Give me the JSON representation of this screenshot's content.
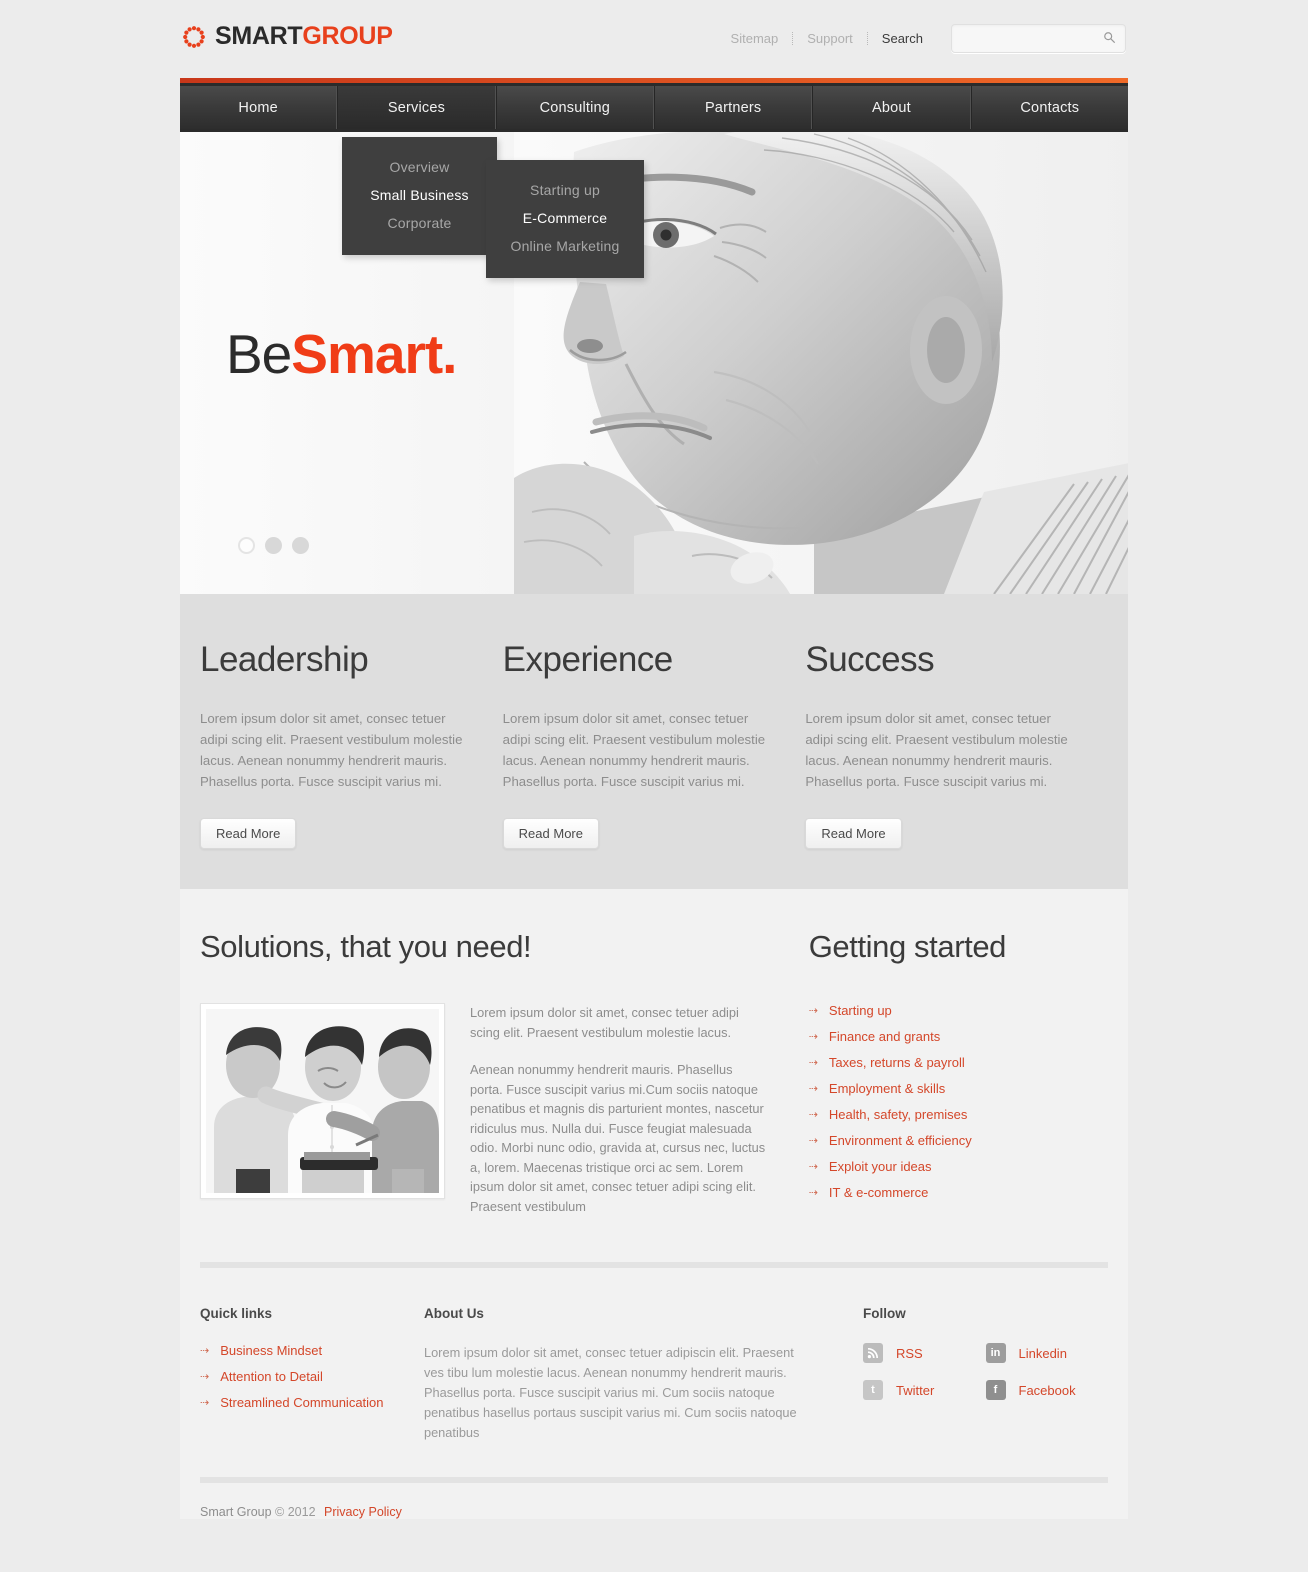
{
  "header": {
    "logo": {
      "part1": "SMART",
      "part2": "GROUP",
      "icon": "gear-ring-icon"
    },
    "toplinks": [
      {
        "label": "Sitemap",
        "style": "muted"
      },
      {
        "label": "Support",
        "style": "muted"
      },
      {
        "label": "Search",
        "style": "dark"
      }
    ],
    "search": {
      "value": "",
      "placeholder": "",
      "icon": "search-icon"
    }
  },
  "nav": {
    "items": [
      {
        "label": "Home",
        "active": false
      },
      {
        "label": "Services",
        "active": true
      },
      {
        "label": "Consulting",
        "active": false
      },
      {
        "label": "Partners",
        "active": false
      },
      {
        "label": "About",
        "active": false
      },
      {
        "label": "Contacts",
        "active": false
      }
    ]
  },
  "dropdowns": {
    "services": {
      "items": [
        {
          "label": "Overview",
          "current": false
        },
        {
          "label": "Small Business",
          "current": true
        },
        {
          "label": "Corporate",
          "current": false
        }
      ]
    },
    "small_business": {
      "items": [
        {
          "label": "Starting up",
          "current": false
        },
        {
          "label": "E-Commerce",
          "current": true
        },
        {
          "label": "Online Marketing",
          "current": false
        }
      ]
    }
  },
  "hero": {
    "title_light": "Be",
    "title_bold": "Smart.",
    "slides": [
      {
        "active": true
      },
      {
        "active": false
      },
      {
        "active": false
      }
    ],
    "image_alt": "older-businessman-portrait"
  },
  "features": [
    {
      "heading": "Leadership",
      "body": "Lorem ipsum dolor sit amet, consec tetuer adipi scing elit. Praesent vestibulum molestie lacus. Aenean nonummy hendrerit mauris. Phasellus porta. Fusce suscipit varius mi.",
      "button": "Read More"
    },
    {
      "heading": "Experience",
      "body": "Lorem ipsum dolor sit amet, consec tetuer adipi scing elit. Praesent vestibulum molestie lacus. Aenean nonummy hendrerit mauris. Phasellus porta. Fusce suscipit varius mi.",
      "button": "Read More"
    },
    {
      "heading": "Success",
      "body": "Lorem ipsum dolor sit amet, consec tetuer adipi scing elit. Praesent vestibulum molestie lacus. Aenean nonummy hendrerit mauris. Phasellus porta. Fusce suscipit varius mi.",
      "button": "Read More"
    }
  ],
  "solutions": {
    "heading": "Solutions, that you need!",
    "image_alt": "three-businessmen-talking",
    "para1": "Lorem ipsum dolor sit amet, consec tetuer adipi scing elit. Praesent vestibulum molestie lacus.",
    "para2": "Aenean nonummy hendrerit mauris. Phasellus porta. Fusce suscipit varius mi.Cum sociis natoque penatibus et magnis dis parturient montes, nascetur ridiculus mus. Nulla dui. Fusce feugiat malesuada odio. Morbi nunc odio, gravida at, cursus nec, luctus a, lorem. Maecenas tristique orci ac sem. Lorem ipsum dolor sit amet, consec tetuer adipi scing elit. Praesent vestibulum"
  },
  "getting_started": {
    "heading": "Getting started",
    "items": [
      "Starting up",
      "Finance and grants",
      "Taxes, returns & payroll",
      "Employment & skills",
      "Health, safety, premises",
      "Environment & efficiency",
      "Exploit your ideas",
      "IT & e-commerce"
    ]
  },
  "footer": {
    "quick_links": {
      "heading": "Quick links",
      "items": [
        "Business Mindset",
        "Attention to Detail",
        "Streamlined Communication"
      ]
    },
    "about": {
      "heading": "About Us",
      "body": "Lorem ipsum dolor sit amet, consec tetuer adipiscin elit. Praesent ves tibu lum molestie lacus. Aenean nonummy hendrerit mauris. Phasellus porta. Fusce suscipit varius mi. Cum sociis natoque penatibus hasellus portaus suscipit varius mi. Cum sociis natoque penatibus"
    },
    "follow": {
      "heading": "Follow",
      "items": [
        {
          "label": "RSS",
          "icon": "rss-icon",
          "color": "#bcbcbc"
        },
        {
          "label": "Linkedin",
          "icon": "linkedin-icon",
          "color": "#9d9d9d"
        },
        {
          "label": "Twitter",
          "icon": "twitter-icon",
          "color": "#c6c6c6"
        },
        {
          "label": "Facebook",
          "icon": "facebook-icon",
          "color": "#8f8f8f"
        }
      ]
    },
    "copyright_name": "Smart Group",
    "copyright_mark": "© 2012",
    "privacy": "Privacy Policy"
  },
  "colors": {
    "accent_red": "#d4472a",
    "logo_red": "#e8401c",
    "hero_red": "#f03c17",
    "nav_dark": "#3a3a3a",
    "page_bg": "#ececec",
    "band_bg": "#dedede"
  }
}
